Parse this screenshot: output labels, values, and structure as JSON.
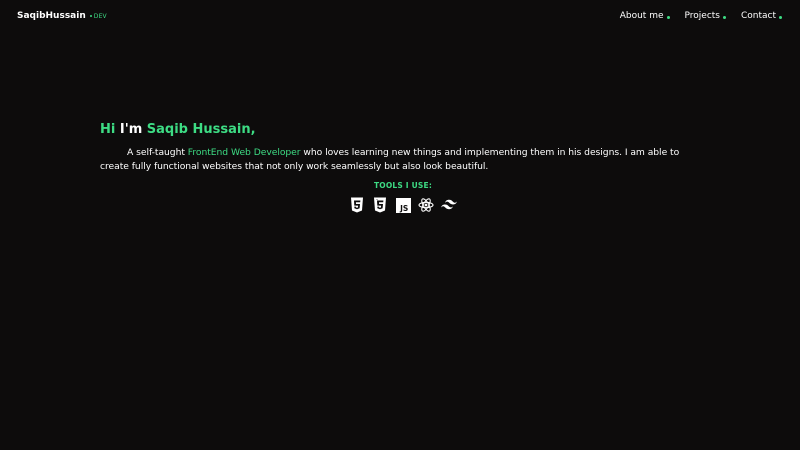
{
  "nav": {
    "logo_name": "SaqibHussain",
    "logo_suffix": "DEV",
    "links": [
      {
        "label": "About me"
      },
      {
        "label": "Projects"
      },
      {
        "label": "Contact"
      }
    ]
  },
  "hero": {
    "greeting_prefix": "Hi",
    "greeting_im": "I'm",
    "greeting_name": "Saqib Hussain,",
    "intro_before": "A self-taught ",
    "intro_role": "FrontEnd Web Developer",
    "intro_after": " who loves learning new things and implementing them in his designs. I am able to create fully functional websites that not only work seamlessly but also look beautiful.",
    "tools_title": "TOOLS I USE:",
    "tools": [
      {
        "icon": "html5-icon"
      },
      {
        "icon": "css3-icon"
      },
      {
        "icon": "javascript-icon",
        "text": "JS"
      },
      {
        "icon": "react-icon"
      },
      {
        "icon": "tailwind-icon"
      }
    ]
  },
  "colors": {
    "background": "#0d0c0c",
    "accent": "#3ddc84",
    "text": "#ffffff"
  }
}
